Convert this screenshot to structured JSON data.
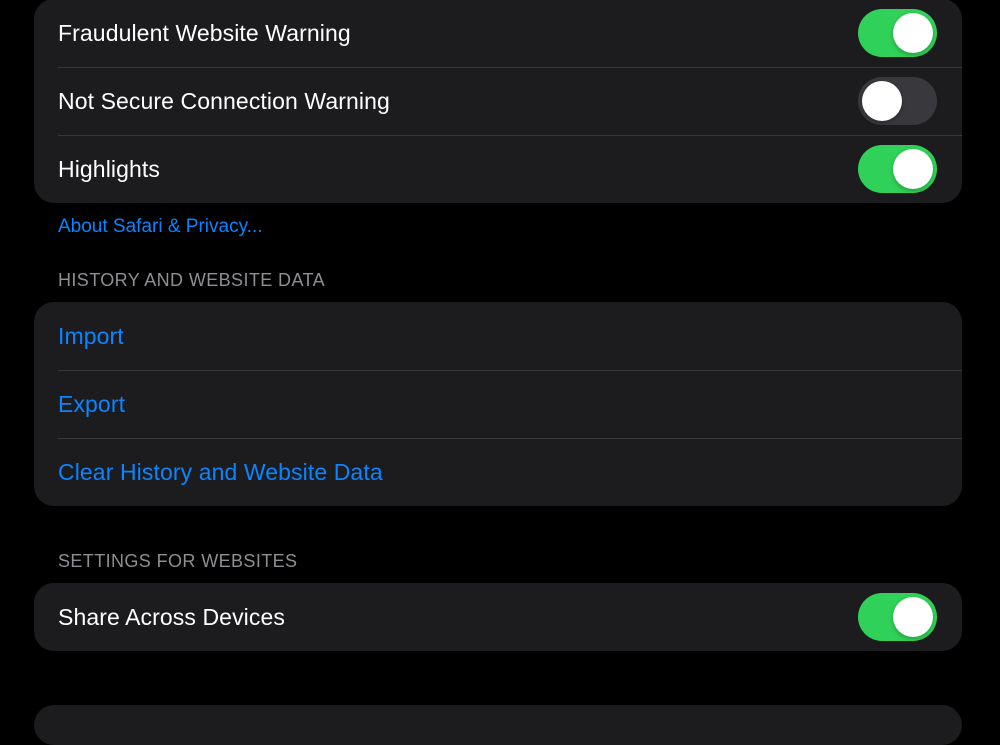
{
  "colors": {
    "background": "#000000",
    "group_background": "#1c1c1e",
    "separator": "#38383a",
    "accent": "#0a84ff",
    "toggle_on": "#30d158",
    "toggle_off": "#39393d",
    "secondary_text": "#8e8e93"
  },
  "security": {
    "rows": [
      {
        "label": "Fraudulent Website Warning",
        "toggle": true
      },
      {
        "label": "Not Secure Connection Warning",
        "toggle": false
      },
      {
        "label": "Highlights",
        "toggle": true
      }
    ],
    "footer_link": "About Safari & Privacy..."
  },
  "history": {
    "header": "HISTORY AND WEBSITE DATA",
    "rows": [
      {
        "label": "Import"
      },
      {
        "label": "Export"
      },
      {
        "label": "Clear History and Website Data"
      }
    ]
  },
  "websites": {
    "header": "SETTINGS FOR WEBSITES",
    "rows": [
      {
        "label": "Share Across Devices",
        "toggle": true
      }
    ]
  }
}
